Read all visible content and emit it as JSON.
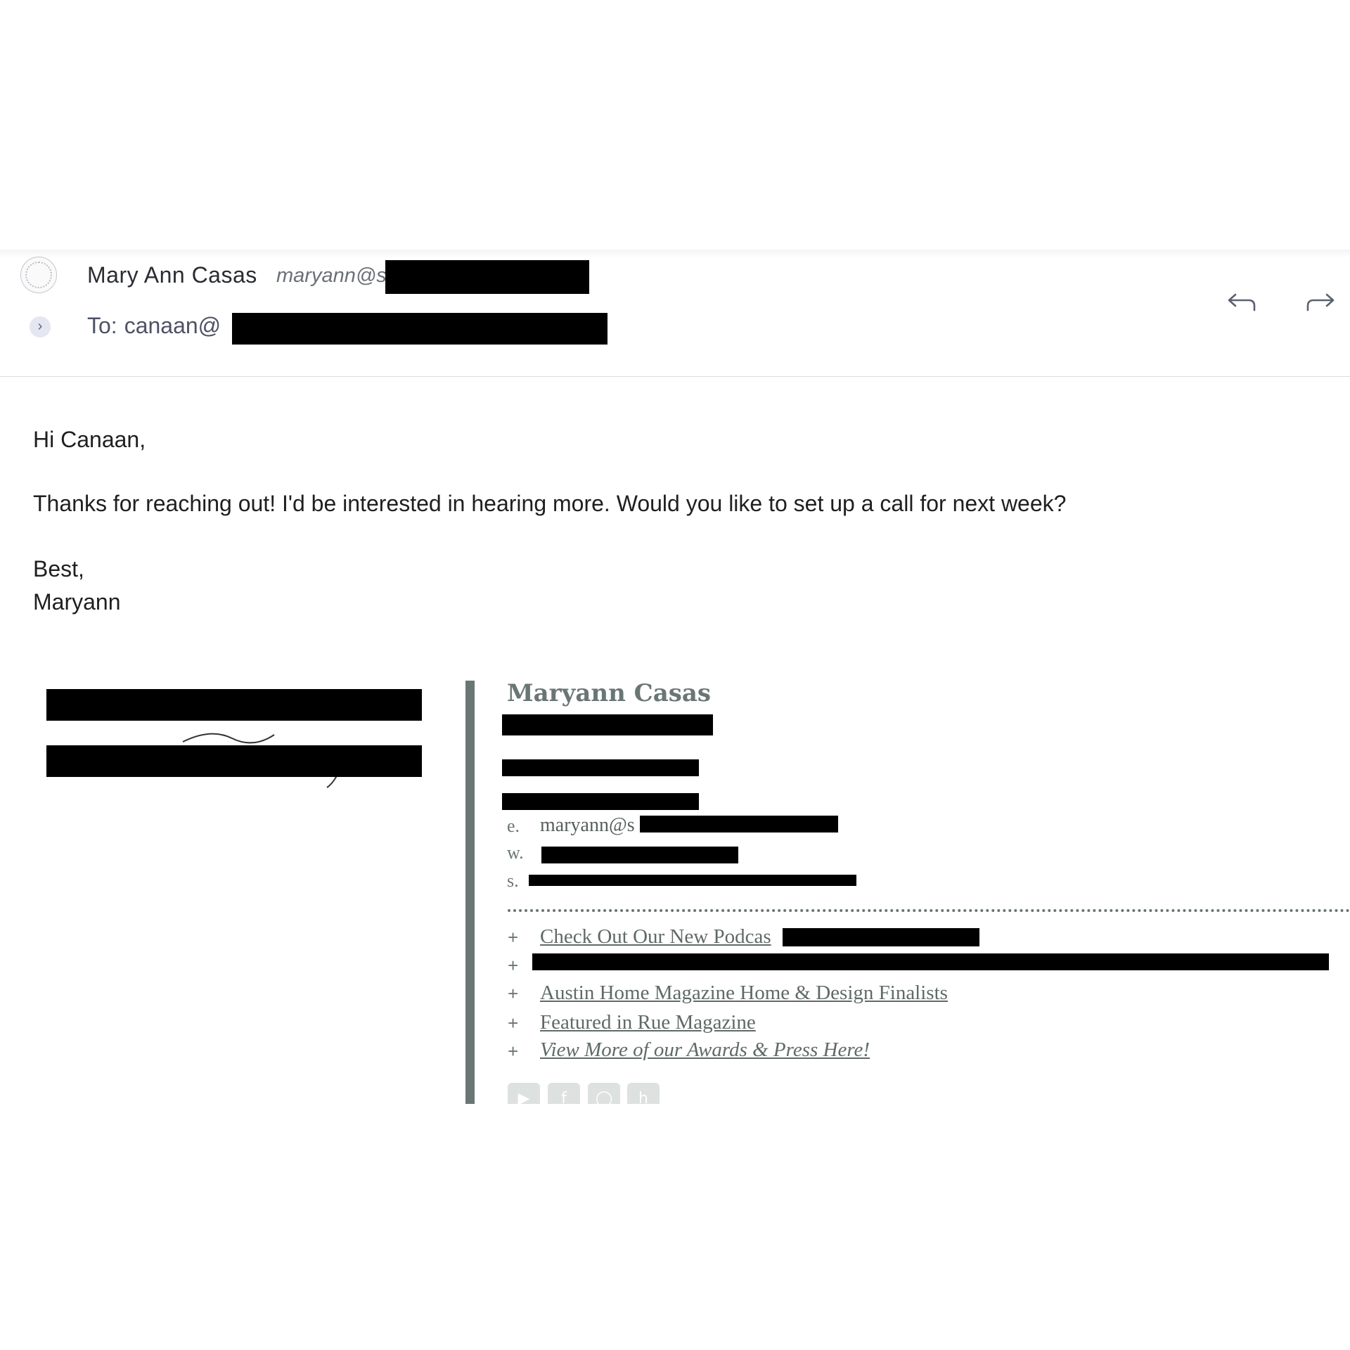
{
  "header": {
    "sender_name": "Mary Ann Casas",
    "sender_email_visible": "maryann@s",
    "to_label": "To:",
    "to_visible": "canaan@",
    "expand_glyph": "›",
    "reply_icon": "reply-icon",
    "forward_icon": "forward-icon"
  },
  "message": {
    "greeting": "Hi Canaan,",
    "body": "Thanks for reaching out! I'd be interested in hearing more. Would you like to set up a call for next week?",
    "closing": "Best,",
    "signoff": "Maryann"
  },
  "signature": {
    "name": "Maryann Casas",
    "email_prefix": "e.",
    "email_visible": "maryann@s",
    "web_prefix": "w.",
    "street_prefix": "s.",
    "links": [
      {
        "label": "Check Out Our New Podcas"
      },
      {
        "label": ""
      },
      {
        "label": "Austin Home Magazine Home & Design Finalists"
      },
      {
        "label": "Featured in Rue Magazine"
      },
      {
        "label": "View More of our Awards & Press Here!"
      }
    ],
    "plus_glyph": "+",
    "social_icons": [
      "youtube-icon",
      "facebook-icon",
      "instagram-icon",
      "houzz-icon"
    ]
  },
  "colors": {
    "signature_accent": "#6a7674",
    "redaction": "#000000"
  }
}
